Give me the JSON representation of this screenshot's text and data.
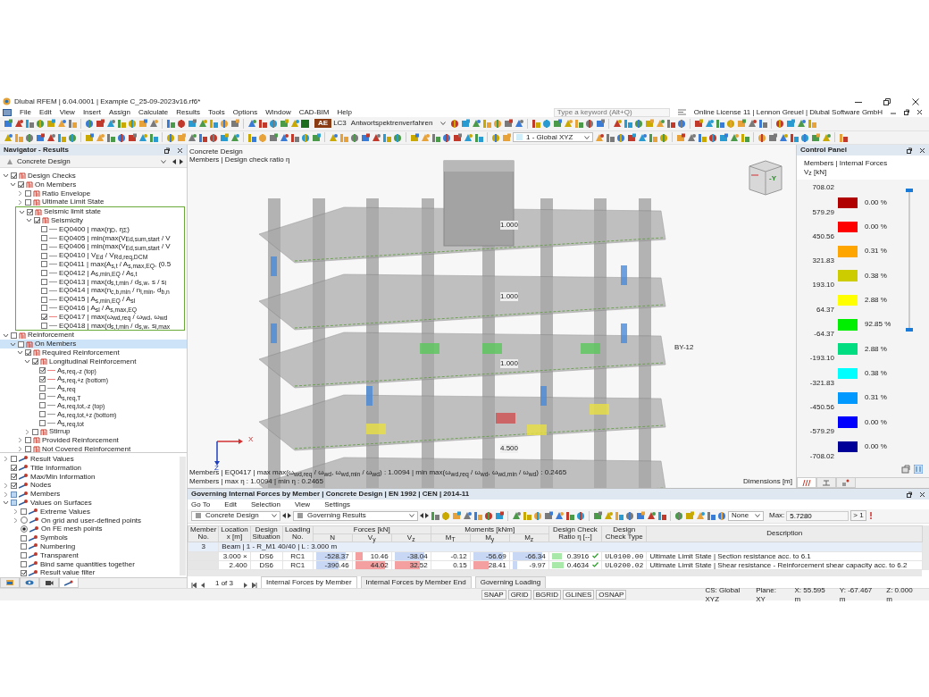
{
  "window": {
    "title": "Dlubal RFEM | 6.04.0001 | Example C_25-09-2023v16.rf6*"
  },
  "menu": [
    "File",
    "Edit",
    "View",
    "Insert",
    "Assign",
    "Calculate",
    "Results",
    "Tools",
    "Options",
    "Window",
    "CAD-BIM",
    "Help"
  ],
  "search": {
    "placeholder": "Type a keyword (Alt+Q)"
  },
  "license": "Online License 11 | Lennon Greuel | Dlubal Software GmbH",
  "toolbar": {
    "load_case_badge": "AE",
    "load_case": "LC3",
    "load_case_name": "Antwortspektrenverfahren",
    "coordinate_system": "1 - Global XYZ"
  },
  "navigator": {
    "title": "Navigator - Results",
    "module": "Concrete Design",
    "tree": [
      {
        "label": "Design Checks",
        "kind": "folder",
        "checked": true,
        "expanded": true,
        "selected": false,
        "children": [
          {
            "label": "On Members",
            "kind": "folder",
            "checked": true,
            "expanded": true,
            "selected": false,
            "children": [
              {
                "label": "Ratio Envelope",
                "kind": "folder",
                "checked": false,
                "expanded": false,
                "selected": false
              },
              {
                "label": "Ultimate Limit State",
                "kind": "folder",
                "checked": false,
                "expanded": false,
                "selected": false
              },
              {
                "label": "Seismic limit state",
                "kind": "folder",
                "checked": true,
                "expanded": true,
                "selected": false,
                "framed": true,
                "children": [
                  {
                    "label": "Seismicity",
                    "kind": "folder",
                    "checked": true,
                    "expanded": true,
                    "selected": false,
                    "children": [
                      {
                        "label": "EQ0400 | max(η$_{D}$, η$_{Σ}$)",
                        "kind": "leaf",
                        "checked": false,
                        "selected": false
                      },
                      {
                        "label": "EQ0405 | min(max(V$_{Ed,sum,start}$ / V",
                        "kind": "leaf",
                        "checked": false,
                        "selected": false
                      },
                      {
                        "label": "EQ0406 | min(max(V$_{Ed,sum,start}$ / V",
                        "kind": "leaf",
                        "checked": false,
                        "selected": false
                      },
                      {
                        "label": "EQ0410 | V$_{Ed}$ / V$_{Rd,req,DCM}$",
                        "kind": "leaf",
                        "checked": false,
                        "selected": false
                      },
                      {
                        "label": "EQ0411 | max(A$_{s,t}$ / A$_{s,max,EQ}$, (0.5",
                        "kind": "leaf",
                        "checked": false,
                        "selected": false
                      },
                      {
                        "label": "EQ0412 | A$_{s,min,EQ}$ / A$_{s,t}$",
                        "kind": "leaf",
                        "checked": false,
                        "selected": false
                      },
                      {
                        "label": "EQ0413 | max(d$_{s,t,min}$ / d$_{s,w}$, s / s$_{l}$",
                        "kind": "leaf",
                        "checked": false,
                        "selected": false
                      },
                      {
                        "label": "EQ0414 | max(n$_{c,b,min}$ / n$_{l,min}$, d$_{b,n}$",
                        "kind": "leaf",
                        "checked": false,
                        "selected": false
                      },
                      {
                        "label": "EQ0415 | A$_{s,min,EQ}$ / A$_{sl}$",
                        "kind": "leaf",
                        "checked": false,
                        "selected": false
                      },
                      {
                        "label": "EQ0416 | A$_{sl}$ / A$_{s,max,EQ}$",
                        "kind": "leaf",
                        "checked": false,
                        "selected": false
                      },
                      {
                        "label": "EQ0417 | max(ω$_{wd,req}$ / ω$_{wd}$, ω$_{wd}$",
                        "kind": "leaf",
                        "checked": true,
                        "selected": false
                      },
                      {
                        "label": "EQ0418 | max(d$_{s,t,min}$ / d$_{s,w}$, s$_{l,max}$",
                        "kind": "leaf",
                        "checked": false,
                        "selected": false
                      }
                    ]
                  }
                ]
              }
            ]
          }
        ]
      },
      {
        "label": "Reinforcement",
        "kind": "folder",
        "checked": false,
        "expanded": true,
        "selected": false,
        "children": [
          {
            "label": "On Members",
            "kind": "folder",
            "checked": false,
            "expanded": true,
            "selected": true,
            "children": [
              {
                "label": "Required Reinforcement",
                "kind": "folder",
                "checked": true,
                "expanded": true,
                "selected": false,
                "children": [
                  {
                    "label": "Longitudinal Reinforcement",
                    "kind": "folder",
                    "checked": true,
                    "expanded": true,
                    "selected": false,
                    "children": [
                      {
                        "label": "A$_{s,req,-z (top)}$",
                        "kind": "leaf",
                        "checked": true,
                        "selected": false
                      },
                      {
                        "label": "A$_{s,req,+z (bottom)}$",
                        "kind": "leaf",
                        "checked": true,
                        "selected": false
                      },
                      {
                        "label": "A$_{s,req}$",
                        "kind": "leaf",
                        "checked": false,
                        "selected": false
                      },
                      {
                        "label": "A$_{s,req,T}$",
                        "kind": "leaf",
                        "checked": false,
                        "selected": false
                      },
                      {
                        "label": "A$_{s,req,tot,-z (top)}$",
                        "kind": "leaf",
                        "checked": false,
                        "selected": false
                      },
                      {
                        "label": "A$_{s,req,tot,+z (bottom)}$",
                        "kind": "leaf",
                        "checked": false,
                        "selected": false
                      },
                      {
                        "label": "A$_{s,req,tot}$",
                        "kind": "leaf",
                        "checked": false,
                        "selected": false
                      }
                    ]
                  },
                  {
                    "label": "Stirrup",
                    "kind": "folder",
                    "checked": false,
                    "expanded": false,
                    "selected": false
                  }
                ]
              },
              {
                "label": "Provided Reinforcement",
                "kind": "folder",
                "checked": false,
                "expanded": false,
                "selected": false
              },
              {
                "label": "Not Covered Reinforcement",
                "kind": "folder",
                "checked": false,
                "expanded": false,
                "selected": false
              }
            ]
          }
        ]
      }
    ],
    "options": [
      {
        "label": "Result Values",
        "kind": "checkbox",
        "checked": false,
        "expanded": false
      },
      {
        "label": "Title Information",
        "kind": "checkbox",
        "checked": true
      },
      {
        "label": "Max/Min Information",
        "kind": "checkbox",
        "checked": true
      },
      {
        "label": "Nodes",
        "kind": "checkbox",
        "checked": true,
        "expanded": false
      },
      {
        "label": "Members",
        "kind": "checkbox",
        "indeterminate": true,
        "expanded": false
      },
      {
        "label": "Values on Surfaces",
        "kind": "checkbox",
        "indeterminate": true,
        "expanded": true,
        "children": [
          {
            "label": "Extreme Values",
            "kind": "checkbox",
            "checked": false,
            "expanded": false
          },
          {
            "label": "On grid and user-defined points",
            "kind": "radio",
            "selected": false,
            "expanded": false
          },
          {
            "label": "On FE mesh points",
            "kind": "radio",
            "selected": true
          },
          {
            "label": "Symbols",
            "kind": "checkbox",
            "checked": false
          },
          {
            "label": "Numbering",
            "kind": "checkbox",
            "checked": false
          },
          {
            "label": "Transparent",
            "kind": "checkbox",
            "checked": false
          },
          {
            "label": "Bind same quantities together",
            "kind": "checkbox",
            "checked": false
          },
          {
            "label": "Result value filter",
            "kind": "checkbox",
            "checked": true
          }
        ]
      }
    ],
    "tabs": [
      {
        "selected": false
      },
      {
        "selected": false
      },
      {
        "selected": false
      },
      {
        "selected": true
      }
    ]
  },
  "viewport": {
    "title": "Concrete Design",
    "subtitle": "Members | Design check ratio η",
    "model_labels": [
      "1.000",
      "1.000",
      "1.000",
      "4.500",
      "BY-12"
    ],
    "axes": [
      "X",
      "Z"
    ],
    "cube_label": "-Y",
    "info_lines": [
      "Members | EQ0417 | max max(ω$_{wd,req}$ / ω$_{wd}$, ω$_{wd,min}$ / ω$_{wd}$) : 1.0094 | min max(ω$_{wd,req}$ / ω$_{wd}$, ω$_{wd,min}$ / ω$_{wd}$) : 0.2465",
      "Members | max η : 1.0094 | min η : 0.2465"
    ],
    "dimensions": "Dimensions [m]"
  },
  "control_panel": {
    "title": "Control Panel",
    "subtitle": "Members | Internal Forces",
    "quantity": "V$_{z}$ [kN]",
    "scale_values": [
      "708.02",
      "579.29",
      "450.56",
      "321.83",
      "193.10",
      "64.37",
      "-64.37",
      "-193.10",
      "-321.83",
      "-450.56",
      "-579.29",
      "-708.02"
    ],
    "bands": [
      {
        "color": "#b00000",
        "percent": "0.00 %"
      },
      {
        "color": "#ff0000",
        "percent": "0.00 %"
      },
      {
        "color": "#ffa500",
        "percent": "0.31 %"
      },
      {
        "color": "#cccc00",
        "percent": "0.38 %"
      },
      {
        "color": "#ffff00",
        "percent": "2.88 %"
      },
      {
        "color": "#00ee00",
        "percent": "92.85 %"
      },
      {
        "color": "#00dd80",
        "percent": "2.88 %"
      },
      {
        "color": "#00ffff",
        "percent": "0.38 %"
      },
      {
        "color": "#0099ff",
        "percent": "0.31 %"
      },
      {
        "color": "#0000ff",
        "percent": "0.00 %"
      },
      {
        "color": "#000099",
        "percent": "0.00 %"
      }
    ],
    "slider_thumbs": [
      {
        "level": 1
      },
      {
        "level": 0
      }
    ],
    "tabs": [
      {
        "selected": true
      },
      {
        "selected": false
      },
      {
        "selected": false
      }
    ]
  },
  "results": {
    "title": "Governing Internal Forces by Member | Concrete Design | EN 1992 | CEN | 2014-11",
    "menu": [
      "Go To",
      "Edit",
      "Selection",
      "View",
      "Settings"
    ],
    "module": "Concrete Design",
    "result_type": "Governing Results",
    "filter": "None",
    "max_label": "Max:",
    "max_value": "5.7280",
    "threshold": "> 1",
    "columns": [
      {
        "label": "Member No."
      },
      {
        "label": "Location x [m]"
      },
      {
        "label": "Design Situation"
      },
      {
        "label": "Loading No."
      },
      {
        "group": "Forces [kN]",
        "columns": [
          {
            "label": "N"
          },
          {
            "label": "V$_{y}$"
          },
          {
            "label": "V$_{z}$"
          }
        ]
      },
      {
        "group": "Moments [kNm]",
        "columns": [
          {
            "label": "M$_{T}$"
          },
          {
            "label": "M$_{y}$"
          },
          {
            "label": "M$_{z}$"
          }
        ]
      },
      {
        "label": "Design Check Ratio η [--]"
      },
      {
        "label": "Design Check Type"
      },
      {
        "label": "Description"
      }
    ],
    "rows": [
      {
        "kind": "group",
        "member": "3",
        "text": "Beam | 1 - R_M1 40/40 | L : 3.000 m"
      },
      {
        "kind": "data",
        "location": "3.000 ×",
        "situation": "DS6",
        "loading": "RC1",
        "values": [
          "-528.37",
          "10.46",
          "-38.04",
          "-0.12",
          "-56.69",
          "-66.34"
        ],
        "ratio": "0.3916",
        "passed": true,
        "type": "UL0100.00",
        "description": "Ultimate Limit State | Section resistance acc. to 6.1"
      },
      {
        "kind": "data",
        "location": "2.400",
        "situation": "DS6",
        "loading": "RC1",
        "values": [
          "-390.46",
          "44.02",
          "32.52",
          "0.15",
          "28.41",
          "-9.97"
        ],
        "ratio": "0.4634",
        "passed": true,
        "type": "UL0200.02",
        "description": "Ultimate Limit State | Shear resistance - Reinforcement shear capacity acc. to 6.2"
      }
    ],
    "pager": "1 of 3",
    "tabs": [
      {
        "label": "Internal Forces by Member",
        "selected": true
      },
      {
        "label": "Internal Forces by Member End",
        "selected": false
      },
      {
        "label": "Governing Loading",
        "selected": false
      }
    ]
  },
  "status_bar": {
    "toggles": [
      "SNAP",
      "GRID",
      "BGRID",
      "GLINES",
      "OSNAP"
    ],
    "cs": "CS: Global XYZ",
    "plane": "Plane: XY",
    "x": "X: 55.595 m",
    "y": "Y: -67.467 m",
    "z": "Z: 0.000 m"
  }
}
